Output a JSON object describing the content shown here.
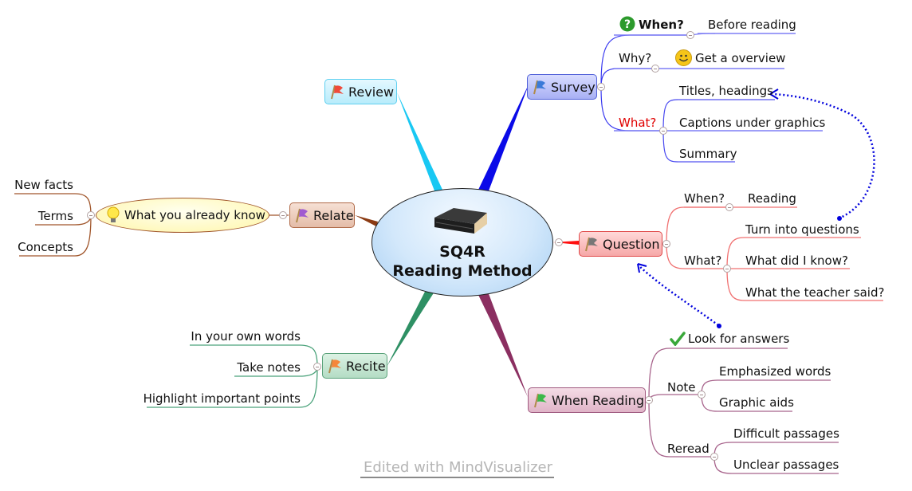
{
  "central": {
    "title_line1": "SQ4R",
    "title_line2": "Reading Method",
    "icon": "book-icon"
  },
  "colors": {
    "survey": "#0000ff",
    "question": "#ff0000",
    "when_reading": "#8b2f61",
    "recite": "#2e8b57",
    "relate": "#8b3a12",
    "review": "#00bfff",
    "relationship": "#0000dd"
  },
  "branches": {
    "review": {
      "label": "Review",
      "flag": "red-flag-icon"
    },
    "survey": {
      "label": "Survey",
      "flag": "blue-flag-icon",
      "when_label": "When?",
      "when_icon": "help-question-icon",
      "when_value": "Before reading",
      "why_label": "Why?",
      "why_icon": "smiley-icon",
      "why_value": "Get a overview",
      "what_label": "What?",
      "what_items": [
        "Titles, headings",
        "Captions under graphics",
        "Summary"
      ]
    },
    "question": {
      "label": "Question",
      "flag": "gray-flag-icon",
      "when_label": "When?",
      "when_value": "Reading",
      "what_label": "What?",
      "what_items": [
        "Turn into questions",
        "What did I know?",
        "What the teacher said?"
      ]
    },
    "when_reading": {
      "label": "When Reading",
      "flag": "green-flag-icon",
      "look_icon": "checkmark-icon",
      "look_value": "Look for answers",
      "note_label": "Note",
      "note_items": [
        "Emphasized words",
        "Graphic aids"
      ],
      "reread_label": "Reread",
      "reread_items": [
        "Difficult passages",
        "Unclear passages"
      ]
    },
    "recite": {
      "label": "Recite",
      "flag": "orange-flag-icon",
      "items": [
        "In your own words",
        "Take notes",
        "Highlight important points"
      ]
    },
    "relate": {
      "label": "Relate",
      "flag": "purple-flag-icon",
      "sub_label": "What you already know",
      "sub_icon": "lightbulb-icon",
      "items": [
        "New facts",
        "Terms",
        "Concepts"
      ]
    }
  },
  "footer": {
    "watermark": "Edited with MindVisualizer"
  }
}
